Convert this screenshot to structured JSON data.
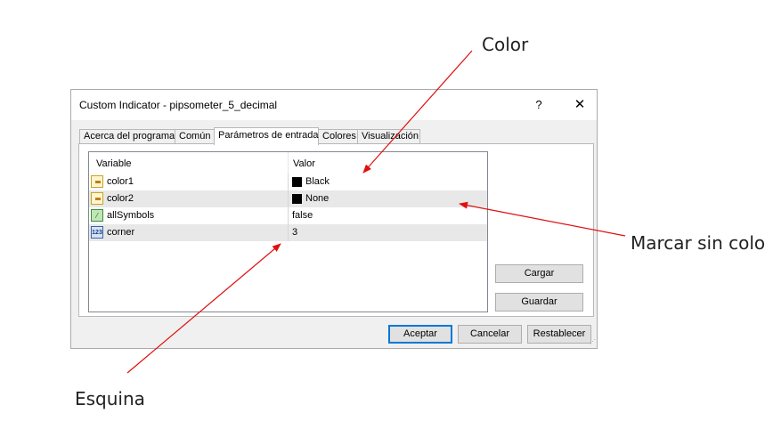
{
  "annotations": {
    "color": "Color",
    "marcar_sin_color": "Marcar sin color",
    "esquina": "Esquina",
    "arrow_color": "#e01010"
  },
  "window": {
    "title": "Custom Indicator - pipsometer_5_decimal",
    "help": "?",
    "close": "✕"
  },
  "tabs": [
    {
      "label": "Acerca del programa",
      "active": false
    },
    {
      "label": "Común",
      "active": false
    },
    {
      "label": "Parámetros de entrada",
      "active": true
    },
    {
      "label": "Colores",
      "active": false
    },
    {
      "label": "Visualización",
      "active": false
    }
  ],
  "table": {
    "headers": {
      "variable": "Variable",
      "valor": "Valor"
    },
    "rows": [
      {
        "icon": "color-param-icon",
        "name": "color1",
        "value": "Black",
        "swatch": "#000000"
      },
      {
        "icon": "color-param-icon",
        "name": "color2",
        "value": "None",
        "swatch": "#000000"
      },
      {
        "icon": "bool-param-icon",
        "name": "allSymbols",
        "value": "false"
      },
      {
        "icon": "int-param-icon",
        "name": "corner",
        "value": "3",
        "icon_text": "123"
      }
    ]
  },
  "buttons": {
    "cargar": "Cargar",
    "guardar": "Guardar",
    "aceptar": "Aceptar",
    "cancelar": "Cancelar",
    "restablecer": "Restablecer"
  }
}
